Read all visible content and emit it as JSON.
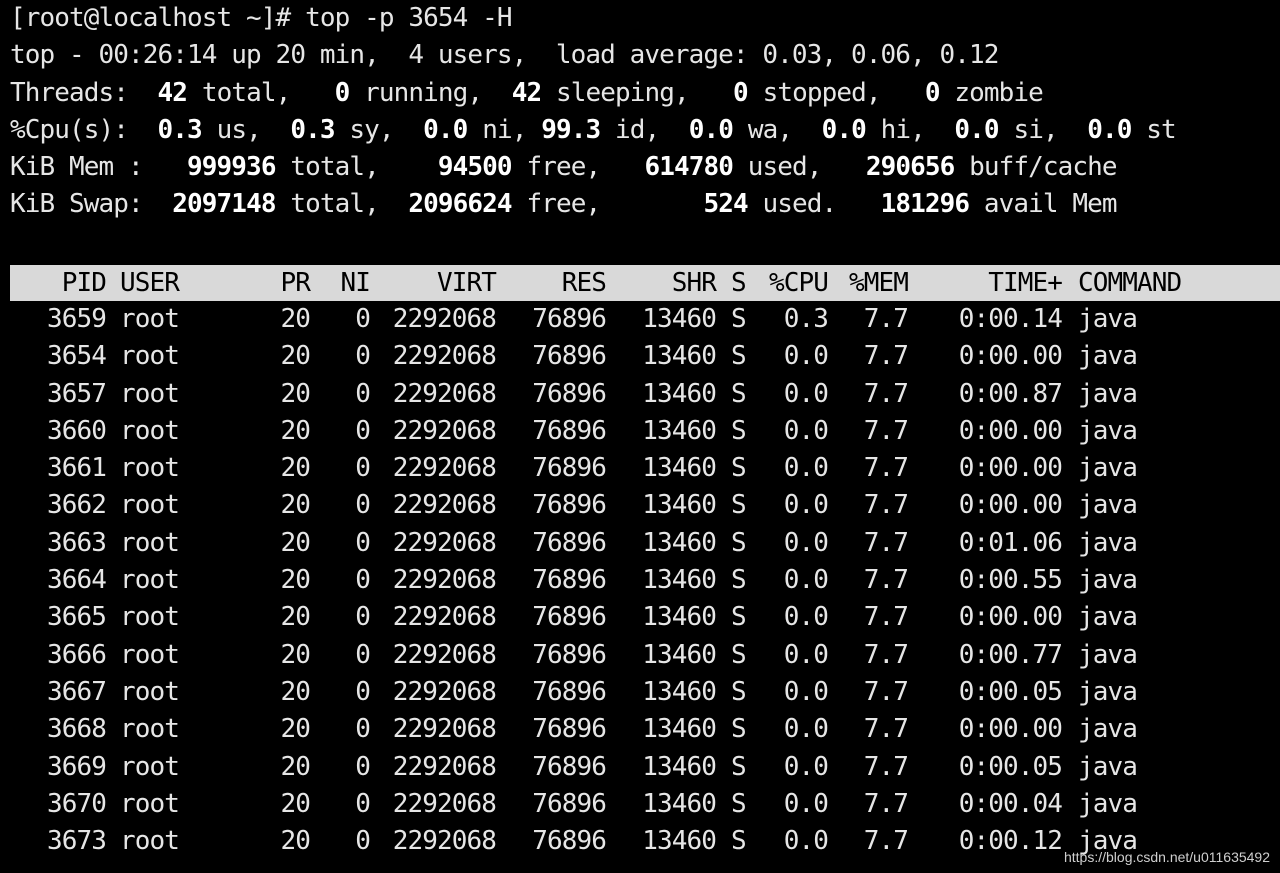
{
  "prompt_line": "[root@localhost ~]# top -p 3654 -H",
  "summary": {
    "top_line": "top - 00:26:14 up 20 min,  4 users,  load average: 0.03, 0.06, 0.12",
    "threads": {
      "label": "Threads:",
      "total": "42",
      "total_label": "total,",
      "running": "0",
      "running_label": "running,",
      "sleeping": "42",
      "sleeping_label": "sleeping,",
      "stopped": "0",
      "stopped_label": "stopped,",
      "zombie": "0",
      "zombie_label": "zombie"
    },
    "cpu": {
      "label": "%Cpu(s):",
      "us": "0.3",
      "us_label": "us,",
      "sy": "0.3",
      "sy_label": "sy,",
      "ni": "0.0",
      "ni_label": "ni,",
      "id": "99.3",
      "id_label": "id,",
      "wa": "0.0",
      "wa_label": "wa,",
      "hi": "0.0",
      "hi_label": "hi,",
      "si": "0.0",
      "si_label": "si,",
      "st": "0.0",
      "st_label": "st"
    },
    "mem": {
      "label": "KiB Mem :",
      "total": "999936",
      "total_label": "total,",
      "free": "94500",
      "free_label": "free,",
      "used": "614780",
      "used_label": "used,",
      "buff": "290656",
      "buff_label": "buff/cache"
    },
    "swap": {
      "label": "KiB Swap:",
      "total": "2097148",
      "total_label": "total,",
      "free": "2096624",
      "free_label": "free,",
      "used": "524",
      "used_label": "used.",
      "avail": "181296",
      "avail_label": "avail Mem"
    }
  },
  "table": {
    "headers": {
      "pid": "PID",
      "user": "USER",
      "pr": "PR",
      "ni": "NI",
      "virt": "VIRT",
      "res": "RES",
      "shr": "SHR",
      "s": "S",
      "cpu": "%CPU",
      "mem": "%MEM",
      "time": "TIME+",
      "cmd": "COMMAND"
    },
    "rows": [
      {
        "pid": "3659",
        "user": "root",
        "pr": "20",
        "ni": "0",
        "virt": "2292068",
        "res": "76896",
        "shr": "13460",
        "s": "S",
        "cpu": "0.3",
        "mem": "7.7",
        "time": "0:00.14",
        "cmd": "java"
      },
      {
        "pid": "3654",
        "user": "root",
        "pr": "20",
        "ni": "0",
        "virt": "2292068",
        "res": "76896",
        "shr": "13460",
        "s": "S",
        "cpu": "0.0",
        "mem": "7.7",
        "time": "0:00.00",
        "cmd": "java"
      },
      {
        "pid": "3657",
        "user": "root",
        "pr": "20",
        "ni": "0",
        "virt": "2292068",
        "res": "76896",
        "shr": "13460",
        "s": "S",
        "cpu": "0.0",
        "mem": "7.7",
        "time": "0:00.87",
        "cmd": "java"
      },
      {
        "pid": "3660",
        "user": "root",
        "pr": "20",
        "ni": "0",
        "virt": "2292068",
        "res": "76896",
        "shr": "13460",
        "s": "S",
        "cpu": "0.0",
        "mem": "7.7",
        "time": "0:00.00",
        "cmd": "java"
      },
      {
        "pid": "3661",
        "user": "root",
        "pr": "20",
        "ni": "0",
        "virt": "2292068",
        "res": "76896",
        "shr": "13460",
        "s": "S",
        "cpu": "0.0",
        "mem": "7.7",
        "time": "0:00.00",
        "cmd": "java"
      },
      {
        "pid": "3662",
        "user": "root",
        "pr": "20",
        "ni": "0",
        "virt": "2292068",
        "res": "76896",
        "shr": "13460",
        "s": "S",
        "cpu": "0.0",
        "mem": "7.7",
        "time": "0:00.00",
        "cmd": "java"
      },
      {
        "pid": "3663",
        "user": "root",
        "pr": "20",
        "ni": "0",
        "virt": "2292068",
        "res": "76896",
        "shr": "13460",
        "s": "S",
        "cpu": "0.0",
        "mem": "7.7",
        "time": "0:01.06",
        "cmd": "java"
      },
      {
        "pid": "3664",
        "user": "root",
        "pr": "20",
        "ni": "0",
        "virt": "2292068",
        "res": "76896",
        "shr": "13460",
        "s": "S",
        "cpu": "0.0",
        "mem": "7.7",
        "time": "0:00.55",
        "cmd": "java"
      },
      {
        "pid": "3665",
        "user": "root",
        "pr": "20",
        "ni": "0",
        "virt": "2292068",
        "res": "76896",
        "shr": "13460",
        "s": "S",
        "cpu": "0.0",
        "mem": "7.7",
        "time": "0:00.00",
        "cmd": "java"
      },
      {
        "pid": "3666",
        "user": "root",
        "pr": "20",
        "ni": "0",
        "virt": "2292068",
        "res": "76896",
        "shr": "13460",
        "s": "S",
        "cpu": "0.0",
        "mem": "7.7",
        "time": "0:00.77",
        "cmd": "java"
      },
      {
        "pid": "3667",
        "user": "root",
        "pr": "20",
        "ni": "0",
        "virt": "2292068",
        "res": "76896",
        "shr": "13460",
        "s": "S",
        "cpu": "0.0",
        "mem": "7.7",
        "time": "0:00.05",
        "cmd": "java"
      },
      {
        "pid": "3668",
        "user": "root",
        "pr": "20",
        "ni": "0",
        "virt": "2292068",
        "res": "76896",
        "shr": "13460",
        "s": "S",
        "cpu": "0.0",
        "mem": "7.7",
        "time": "0:00.00",
        "cmd": "java"
      },
      {
        "pid": "3669",
        "user": "root",
        "pr": "20",
        "ni": "0",
        "virt": "2292068",
        "res": "76896",
        "shr": "13460",
        "s": "S",
        "cpu": "0.0",
        "mem": "7.7",
        "time": "0:00.05",
        "cmd": "java"
      },
      {
        "pid": "3670",
        "user": "root",
        "pr": "20",
        "ni": "0",
        "virt": "2292068",
        "res": "76896",
        "shr": "13460",
        "s": "S",
        "cpu": "0.0",
        "mem": "7.7",
        "time": "0:00.04",
        "cmd": "java"
      },
      {
        "pid": "3673",
        "user": "root",
        "pr": "20",
        "ni": "0",
        "virt": "2292068",
        "res": "76896",
        "shr": "13460",
        "s": "S",
        "cpu": "0.0",
        "mem": "7.7",
        "time": "0:00.12",
        "cmd": "java"
      }
    ]
  },
  "watermark": "https://blog.csdn.net/u011635492"
}
